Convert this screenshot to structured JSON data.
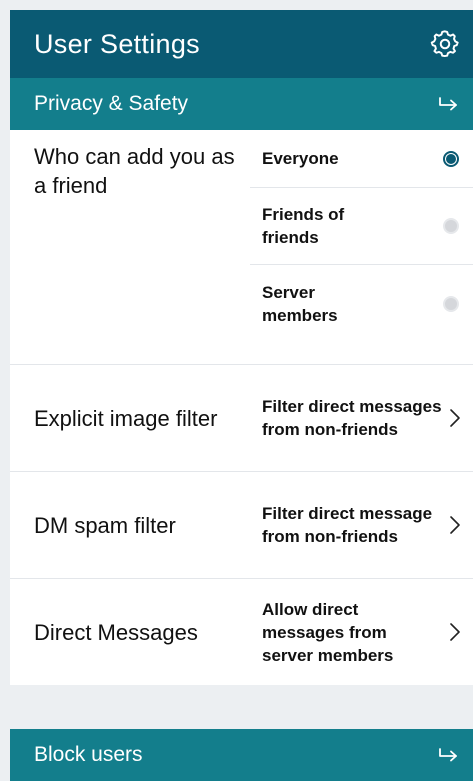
{
  "header": {
    "title": "User Settings",
    "icon": "gear-icon"
  },
  "privacy": {
    "title": "Privacy & Safety",
    "arrow_icon": "arrow-right-hook-icon",
    "friend_requests": {
      "label": "Who can add you as a friend",
      "options": [
        {
          "label": "Everyone",
          "selected": true
        },
        {
          "label": "Friends of friends",
          "selected": false
        },
        {
          "label": "Server members",
          "selected": false
        }
      ]
    },
    "explicit_filter": {
      "label": "Explicit image filter",
      "value": "Filter direct messages from non-friends"
    },
    "dm_spam": {
      "label": "DM spam filter",
      "value": "Filter direct message from non-friends"
    },
    "direct_messages": {
      "label": "Direct Messages",
      "value": "Allow direct messages from server members"
    }
  },
  "block_users": {
    "title": "Block users",
    "arrow_icon": "arrow-right-hook-icon"
  },
  "colors": {
    "header": "#0a5a73",
    "section": "#137e8c",
    "background": "#eceff2"
  }
}
